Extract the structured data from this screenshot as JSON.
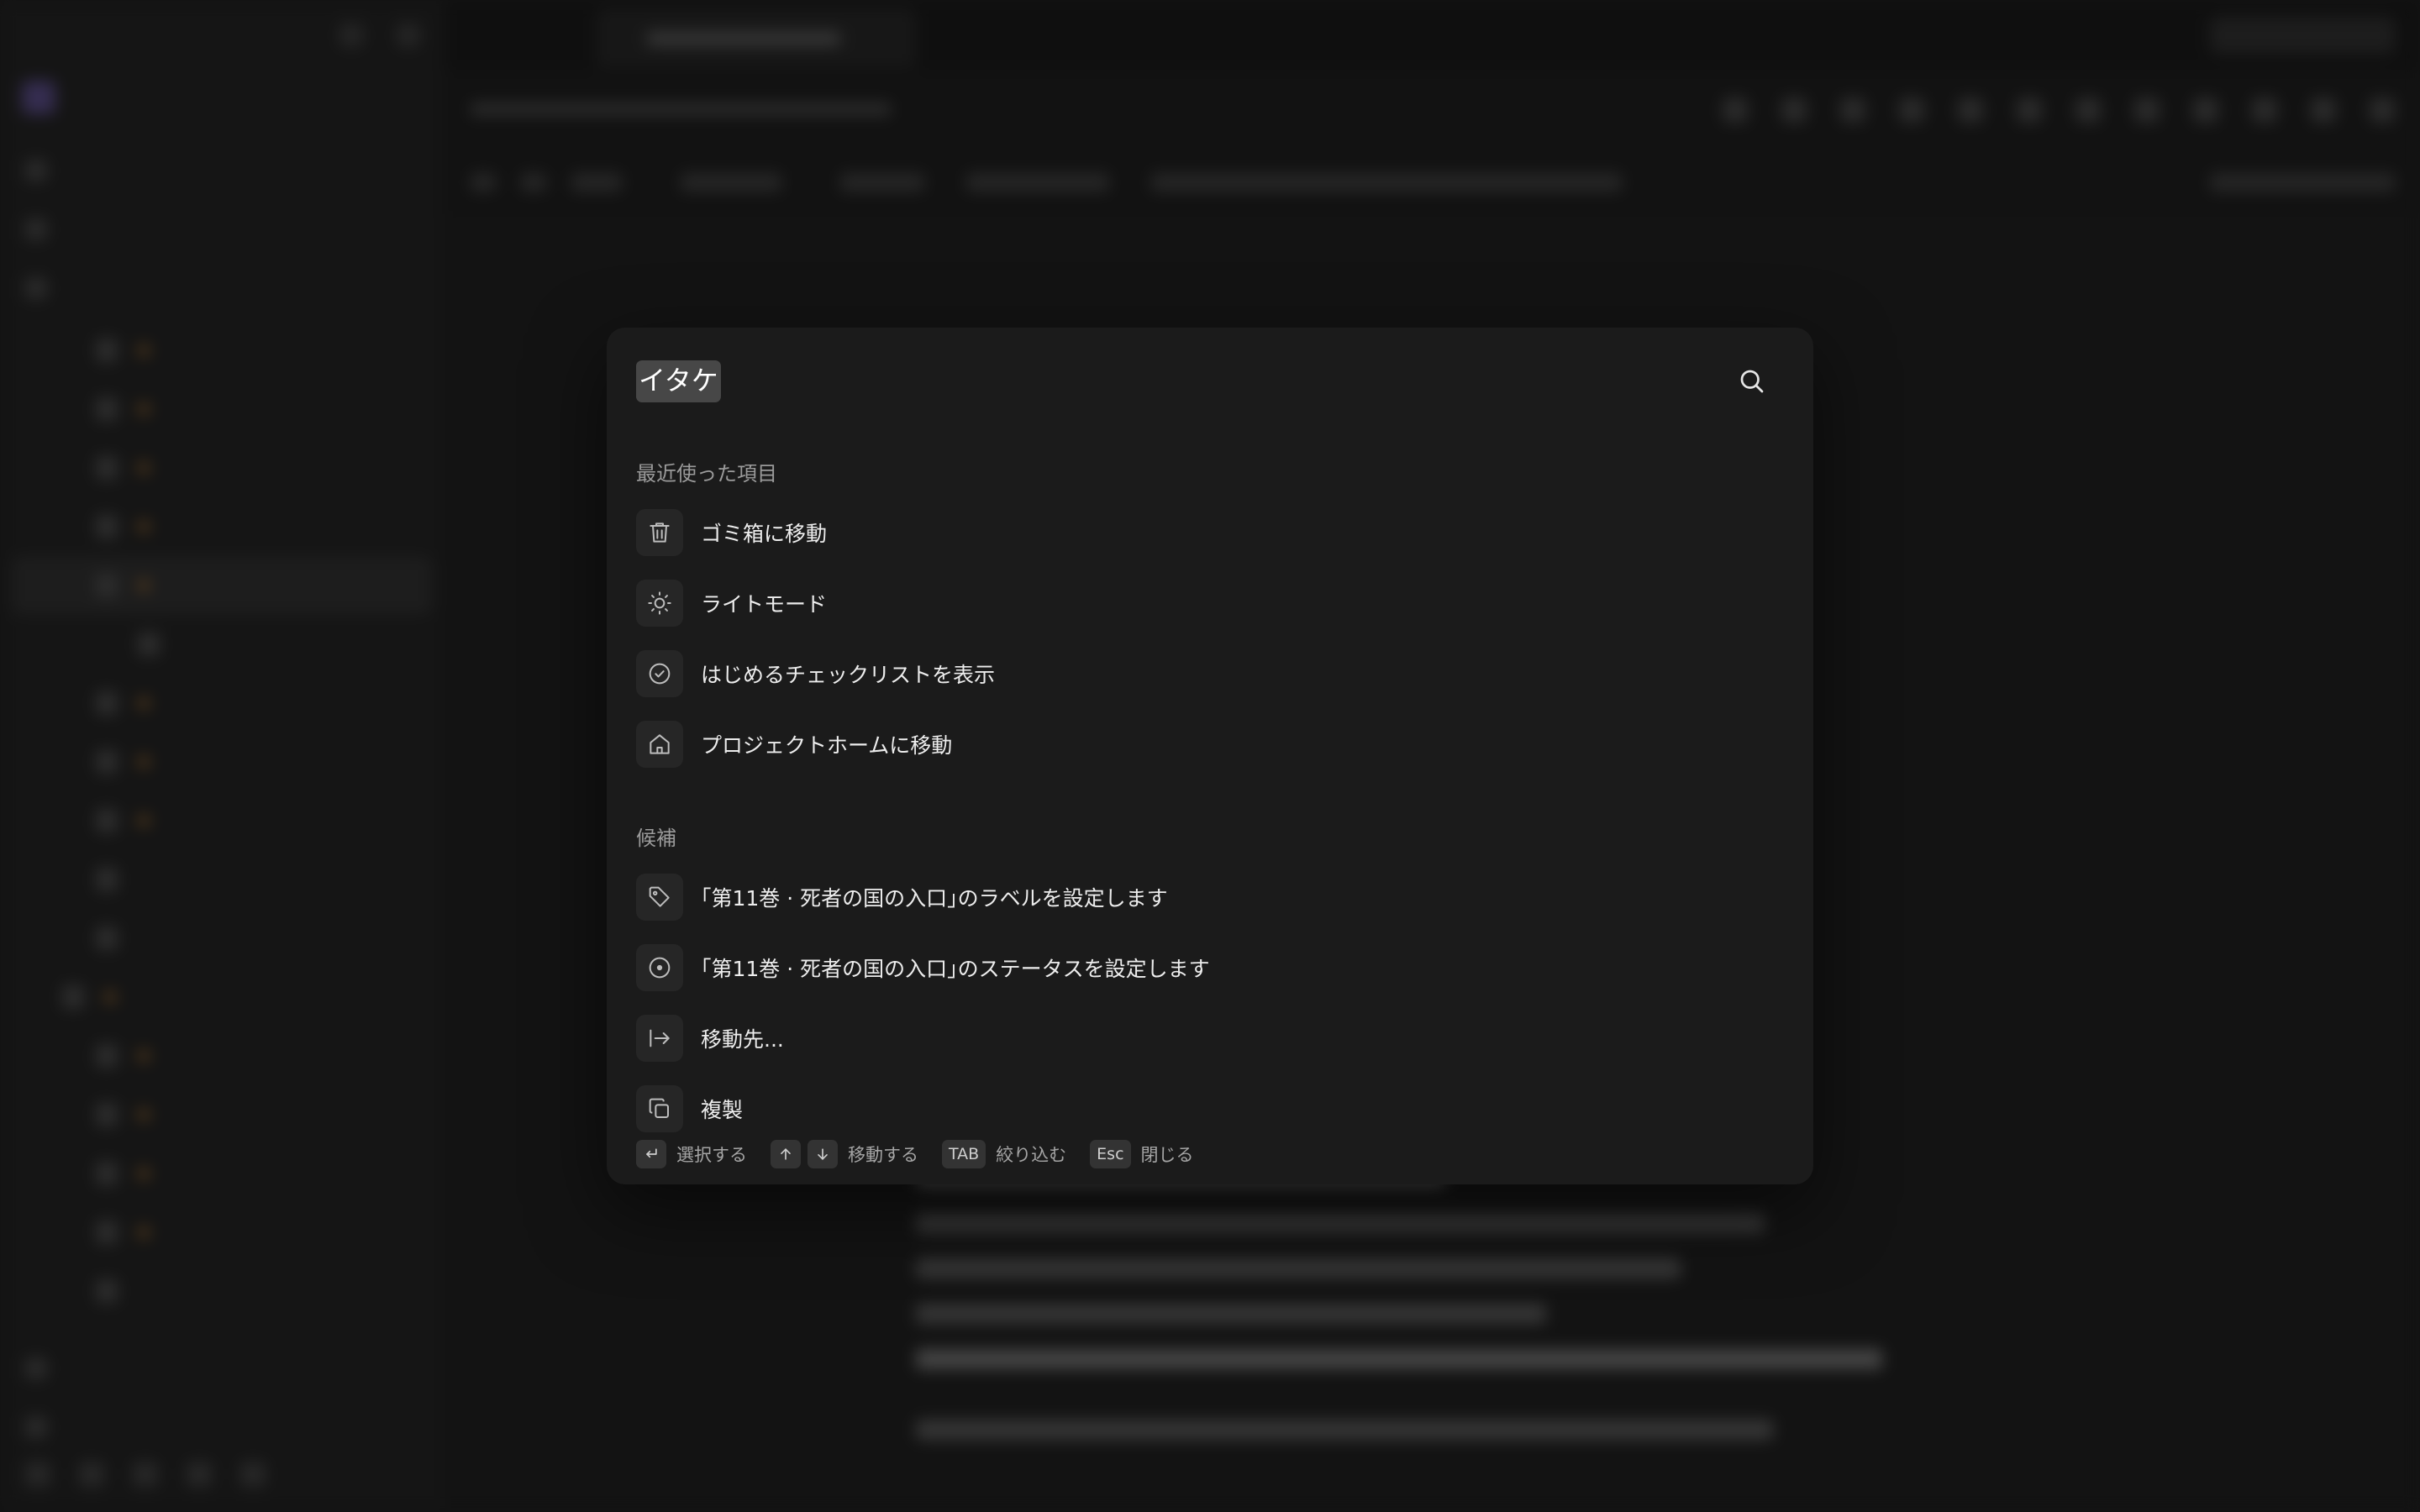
{
  "command_palette": {
    "search": {
      "value": "イタケ",
      "icon": "search-icon"
    },
    "recent": {
      "title": "最近使った項目",
      "items": [
        {
          "label": "ゴミ箱に移動",
          "icon": "trash-icon"
        },
        {
          "label": "ライトモード",
          "icon": "sun-icon"
        },
        {
          "label": "はじめるチェックリストを表示",
          "icon": "check-circle-icon"
        },
        {
          "label": "プロジェクトホームに移動",
          "icon": "home-icon"
        }
      ]
    },
    "suggestions": {
      "title": "候補",
      "items": [
        {
          "label": "｢第11巻 · 死者の国の入口｣のラベルを設定します",
          "icon": "tag-icon"
        },
        {
          "label": "｢第11巻 · 死者の国の入口｣のステータスを設定します",
          "icon": "status-circle-icon"
        },
        {
          "label": "移動先...",
          "icon": "move-to-icon"
        },
        {
          "label": "複製",
          "icon": "duplicate-icon"
        }
      ]
    },
    "footer": {
      "select_label": "選択する",
      "move_label": "移動する",
      "tab_key": "TAB",
      "filter_label": "絞り込む",
      "esc_key": "Esc",
      "close_label": "閉じる"
    }
  },
  "colors": {
    "palette_bg": "#1b1b1b",
    "icon_box_bg": "#262626",
    "search_highlight": "#474747",
    "text_primary": "#ededed",
    "text_secondary": "#9b9b9b"
  }
}
